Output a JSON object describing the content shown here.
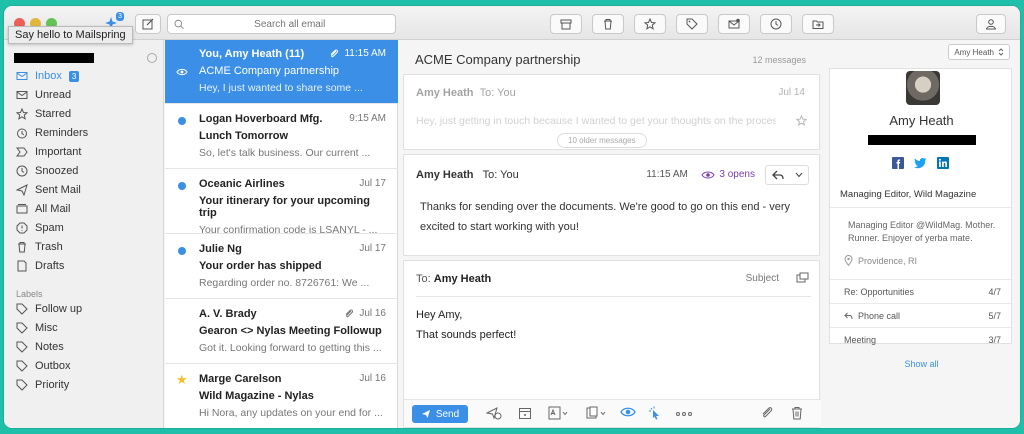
{
  "toolbar": {
    "compose_badge": "3",
    "search_placeholder": "Search all email",
    "tooltip": "Say hello to Mailspring",
    "icons": [
      "archive-icon",
      "trash-icon",
      "star-icon",
      "tag-icon",
      "mark-unread-icon",
      "snooze-icon",
      "move-icon",
      "account-icon"
    ]
  },
  "sidebar": {
    "items": [
      {
        "label": "Inbox",
        "badge": "3",
        "icon": "inbox-icon"
      },
      {
        "label": "Unread",
        "icon": "unread-icon"
      },
      {
        "label": "Starred",
        "icon": "star-icon"
      },
      {
        "label": "Reminders",
        "icon": "reminders-icon"
      },
      {
        "label": "Important",
        "icon": "important-icon"
      },
      {
        "label": "Snoozed",
        "icon": "snoozed-icon"
      },
      {
        "label": "Sent Mail",
        "icon": "sent-icon"
      },
      {
        "label": "All Mail",
        "icon": "all-mail-icon"
      },
      {
        "label": "Spam",
        "icon": "spam-icon"
      },
      {
        "label": "Trash",
        "icon": "trash-icon"
      },
      {
        "label": "Drafts",
        "icon": "drafts-icon"
      }
    ],
    "labels_header": "Labels",
    "labels": [
      {
        "label": "Follow up"
      },
      {
        "label": "Misc"
      },
      {
        "label": "Notes"
      },
      {
        "label": "Outbox"
      },
      {
        "label": "Priority"
      }
    ]
  },
  "messages": [
    {
      "from": "You, Amy Heath (11)",
      "time": "11:15 AM",
      "subject": "ACME Company partnership",
      "snippet": "Hey, I just wanted to share some ..."
    },
    {
      "from": "Logan Hoverboard Mfg.",
      "time": "9:15 AM",
      "subject": "Lunch Tomorrow",
      "snippet": "So, let's talk business. Our current ..."
    },
    {
      "from": "Oceanic Airlines",
      "time": "Jul 17",
      "subject": "Your itinerary for your upcoming trip",
      "snippet": "Your confirmation code is LSANYL - ..."
    },
    {
      "from": "Julie Ng",
      "time": "Jul 17",
      "subject": "Your order has shipped",
      "snippet": "Regarding order no. 8726761: We ..."
    },
    {
      "from": "A. V. Brady",
      "time": "Jul 16",
      "subject": "Gearon <> Nylas Meeting Followup",
      "snippet": "Got it. Looking forward to getting this ..."
    },
    {
      "from": "Marge Carelson",
      "time": "Jul 16",
      "subject": "Wild Magazine - Nylas",
      "snippet": "Hi Nora, any updates on your end for ..."
    }
  ],
  "thread": {
    "title": "ACME Company partnership",
    "count": "12 messages",
    "collapsed": {
      "from": "Amy Heath",
      "to": "To: You",
      "date": "Jul 14",
      "snippet": "Hey, just getting in touch because I wanted to get your thoughts on the process"
    },
    "older": "10 older messages",
    "expanded": {
      "from": "Amy Heath",
      "to": "To: You",
      "time": "11:15 AM",
      "opens": "3 opens",
      "body_line1": "Thanks for sending over the documents. We're good to go on this end - very",
      "body_line2": "excited to start working with you!"
    }
  },
  "composer": {
    "to_label": "To:",
    "to_name": "Amy Heath",
    "subject_label": "Subject",
    "body_line1": "Hey Amy,",
    "body_line2": "That sounds perfect!",
    "send_label": "Send"
  },
  "contact": {
    "selector": "Amy Heath",
    "name": "Amy Heath",
    "title": "Managing Editor, Wild Magazine",
    "bio": "Managing Editor @WildMag. Mother. Runner. Enjoyer of yerba mate.",
    "location": "Providence, RI",
    "rows": [
      {
        "label": "Re: Opportunities",
        "value": "4/7"
      },
      {
        "label": "Phone call",
        "value": "5/7"
      },
      {
        "label": "Meeting",
        "value": "3/7"
      }
    ],
    "show_all": "Show all"
  }
}
